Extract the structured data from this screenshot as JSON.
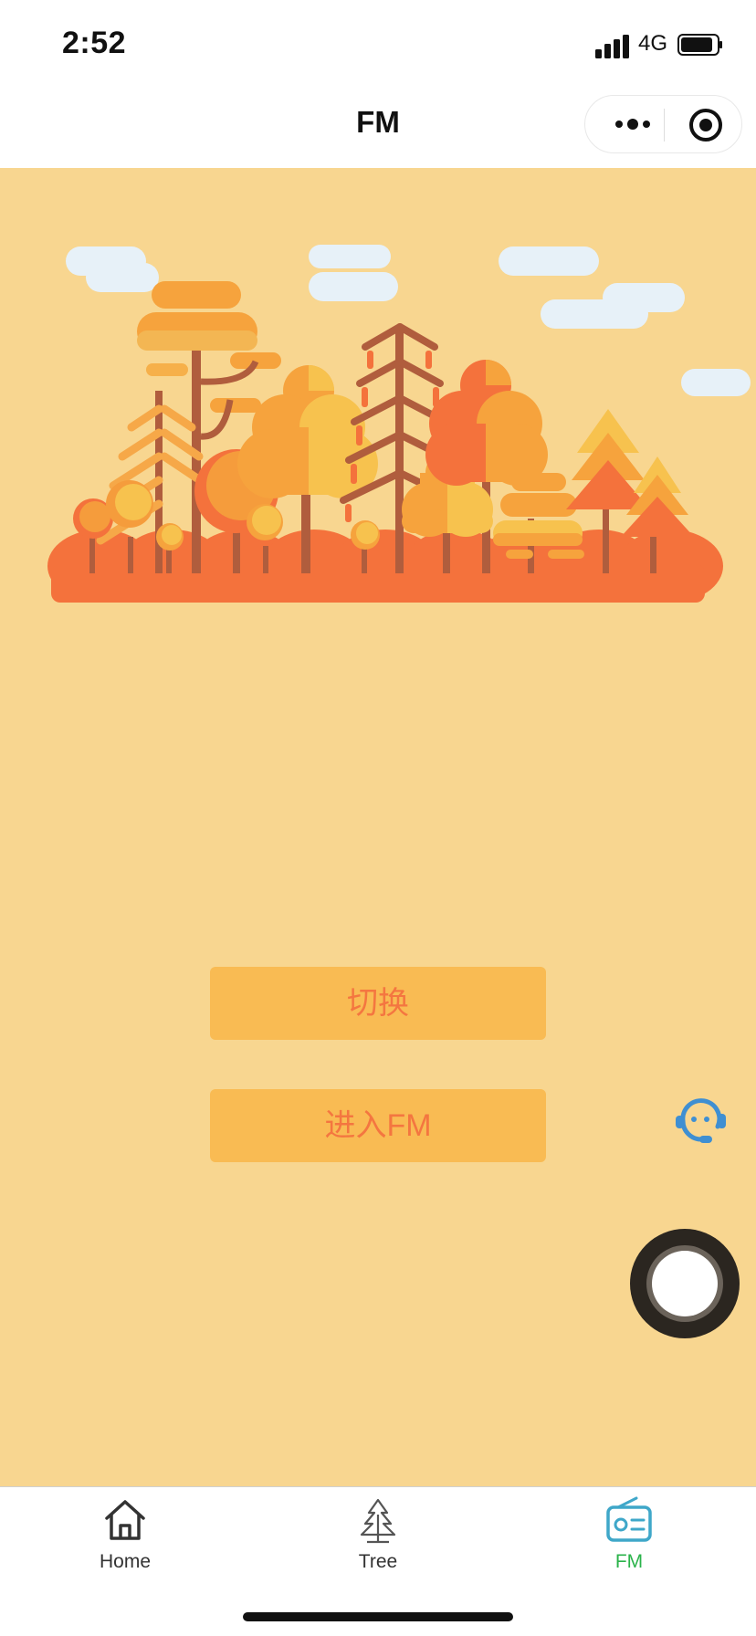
{
  "status_bar": {
    "time": "2:52",
    "network": "4G"
  },
  "nav": {
    "title": "FM"
  },
  "buttons": {
    "switch_label": "切换",
    "enter_label": "进入FM"
  },
  "tabbar": {
    "items": [
      {
        "label": "Home",
        "icon": "home-icon",
        "active": false
      },
      {
        "label": "Tree",
        "icon": "tree-icon",
        "active": false
      },
      {
        "label": "FM",
        "icon": "radio-icon",
        "active": true
      }
    ]
  },
  "colors": {
    "background": "#f8d690",
    "button_fill": "#f9bb53",
    "button_text": "#f47640",
    "active_tab": "#2bb34b",
    "service_icon": "#3f8fd2"
  }
}
